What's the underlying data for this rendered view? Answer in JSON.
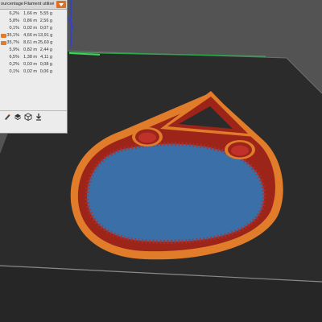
{
  "legend": {
    "columns": [
      "ourcentage",
      "Filament utilisé"
    ],
    "rows": [
      {
        "pct": "6,2%",
        "len": "1,66 m",
        "weight": "5,55 g",
        "color": ""
      },
      {
        "pct": "5,8%",
        "len": "0,86 m",
        "weight": "2,56 g",
        "color": ""
      },
      {
        "pct": "0,1%",
        "len": "0,02 m",
        "weight": "0,07 g",
        "color": ""
      },
      {
        "pct": "35,1%",
        "len": "4,66 m",
        "weight": "13,91 g",
        "color": "#e07c2a"
      },
      {
        "pct": "35,7%",
        "len": "8,61 m",
        "weight": "25,69 g",
        "color": "#e07c2a"
      },
      {
        "pct": "5,9%",
        "len": "0,82 m",
        "weight": "2,44 g",
        "color": ""
      },
      {
        "pct": "6,5%",
        "len": "1,38 m",
        "weight": "4,11 g",
        "color": ""
      },
      {
        "pct": "0,2%",
        "len": "0,03 m",
        "weight": "0,08 g",
        "color": ""
      },
      {
        "pct": "0,1%",
        "len": "0,02 m",
        "weight": "0,06 g",
        "color": ""
      }
    ]
  },
  "toolbar": {
    "icons": [
      "edit-icon",
      "layers-icon",
      "cube-icon",
      "export-icon"
    ]
  },
  "colors": {
    "accent": "#e07020",
    "bed": "#2d2d2d",
    "infill": "#3a6fa8",
    "perimeter": "#e07c2a",
    "perimeter_dark": "#9c2418",
    "background": "#545454"
  }
}
